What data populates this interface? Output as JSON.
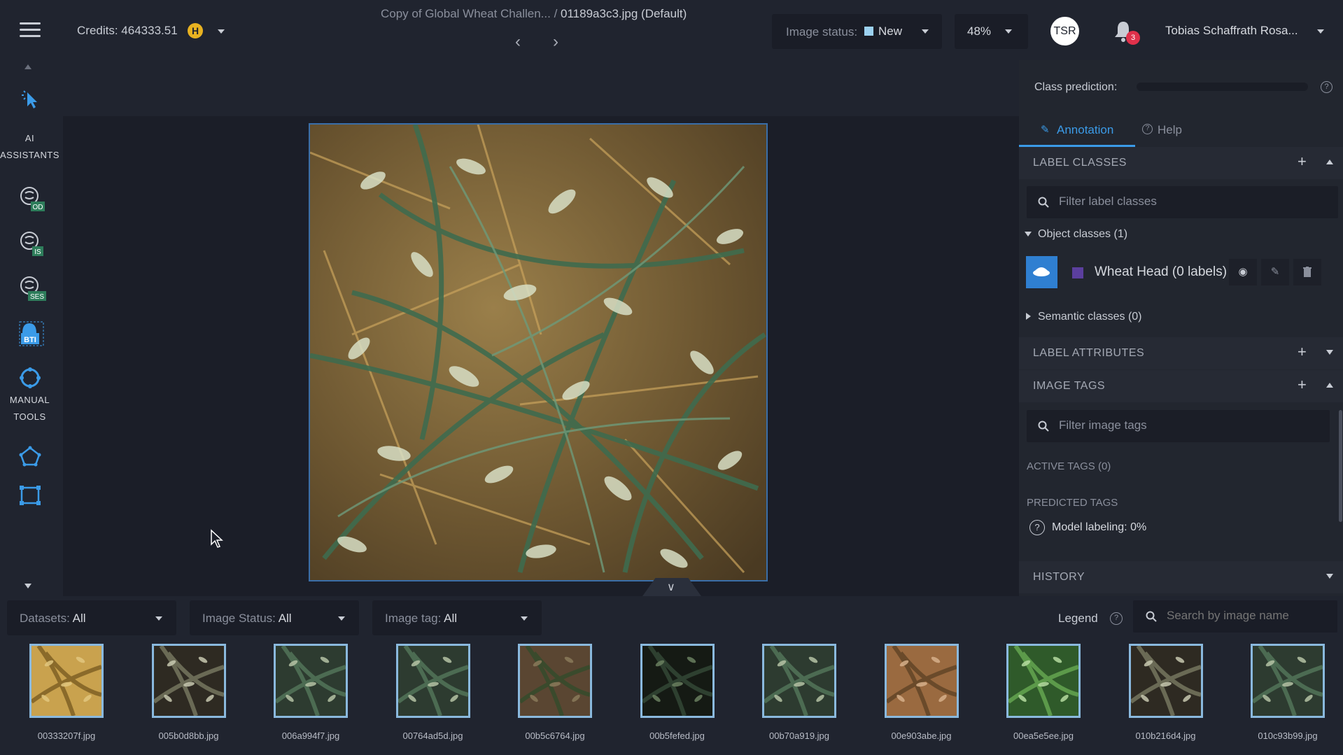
{
  "header": {
    "credits_label": "Credits: 464333.51",
    "coin_letter": "H",
    "project_path": "Copy of Global Wheat Challen... /",
    "file_name": "01189a3c3.jpg (Default)",
    "image_status_label": "Image status:",
    "image_status_value": "New",
    "zoom": "48%",
    "avatar_initials": "TSR",
    "notifications_count": "3",
    "user_name": "Tobias Schaffrath Rosa..."
  },
  "left_toolbar": {
    "ai_label_line1": "AI",
    "ai_label_line2": "ASSISTANTS",
    "tool_od": "OD",
    "tool_is": "IS",
    "tool_ses": "SES",
    "tool_bti": "BTI",
    "manual_label_line1": "MANUAL",
    "manual_label_line2": "TOOLS"
  },
  "right_panel": {
    "class_prediction_label": "Class prediction:",
    "tab_annotation": "Annotation",
    "tab_help": "Help",
    "label_classes_title": "LABEL CLASSES",
    "filter_label_placeholder": "Filter label classes",
    "object_classes": "Object classes (1)",
    "class_name": "Wheat Head (0 labels)",
    "class_color": "#5b3f9e",
    "semantic_classes": "Semantic classes (0)",
    "label_attributes_title": "LABEL ATTRIBUTES",
    "image_tags_title": "IMAGE TAGS",
    "filter_tags_placeholder": "Filter image tags",
    "active_tags": "ACTIVE TAGS (0)",
    "predicted_tags": "PREDICTED TAGS",
    "model_labeling": "Model labeling: 0%",
    "history_title": "HISTORY"
  },
  "bottom_bar": {
    "datasets_label": "Datasets:",
    "datasets_value": "All",
    "image_status_label": "Image Status:",
    "image_status_value": "All",
    "image_tag_label": "Image tag:",
    "image_tag_value": "All",
    "legend_label": "Legend",
    "search_placeholder": "Search by image name",
    "thumbnails": [
      {
        "name": "00333207f.jpg",
        "tone": "golden"
      },
      {
        "name": "005b0d8bb.jpg",
        "tone": "dark-spikes"
      },
      {
        "name": "006a994f7.jpg",
        "tone": "green-dark"
      },
      {
        "name": "00764ad5d.jpg",
        "tone": "green-dark"
      },
      {
        "name": "00b5c6764.jpg",
        "tone": "soil"
      },
      {
        "name": "00b5fefed.jpg",
        "tone": "very-dark"
      },
      {
        "name": "00b70a919.jpg",
        "tone": "green-dark"
      },
      {
        "name": "00e903abe.jpg",
        "tone": "brown"
      },
      {
        "name": "00ea5e5ee.jpg",
        "tone": "bright-green"
      },
      {
        "name": "010b216d4.jpg",
        "tone": "dark-spikes"
      },
      {
        "name": "010c93b99.jpg",
        "tone": "green-dark"
      }
    ]
  },
  "colors": {
    "accent": "#3b9be8",
    "status_new": "#9bd1f0",
    "notification_badge": "#e0314b",
    "coin": "#e8b221"
  }
}
